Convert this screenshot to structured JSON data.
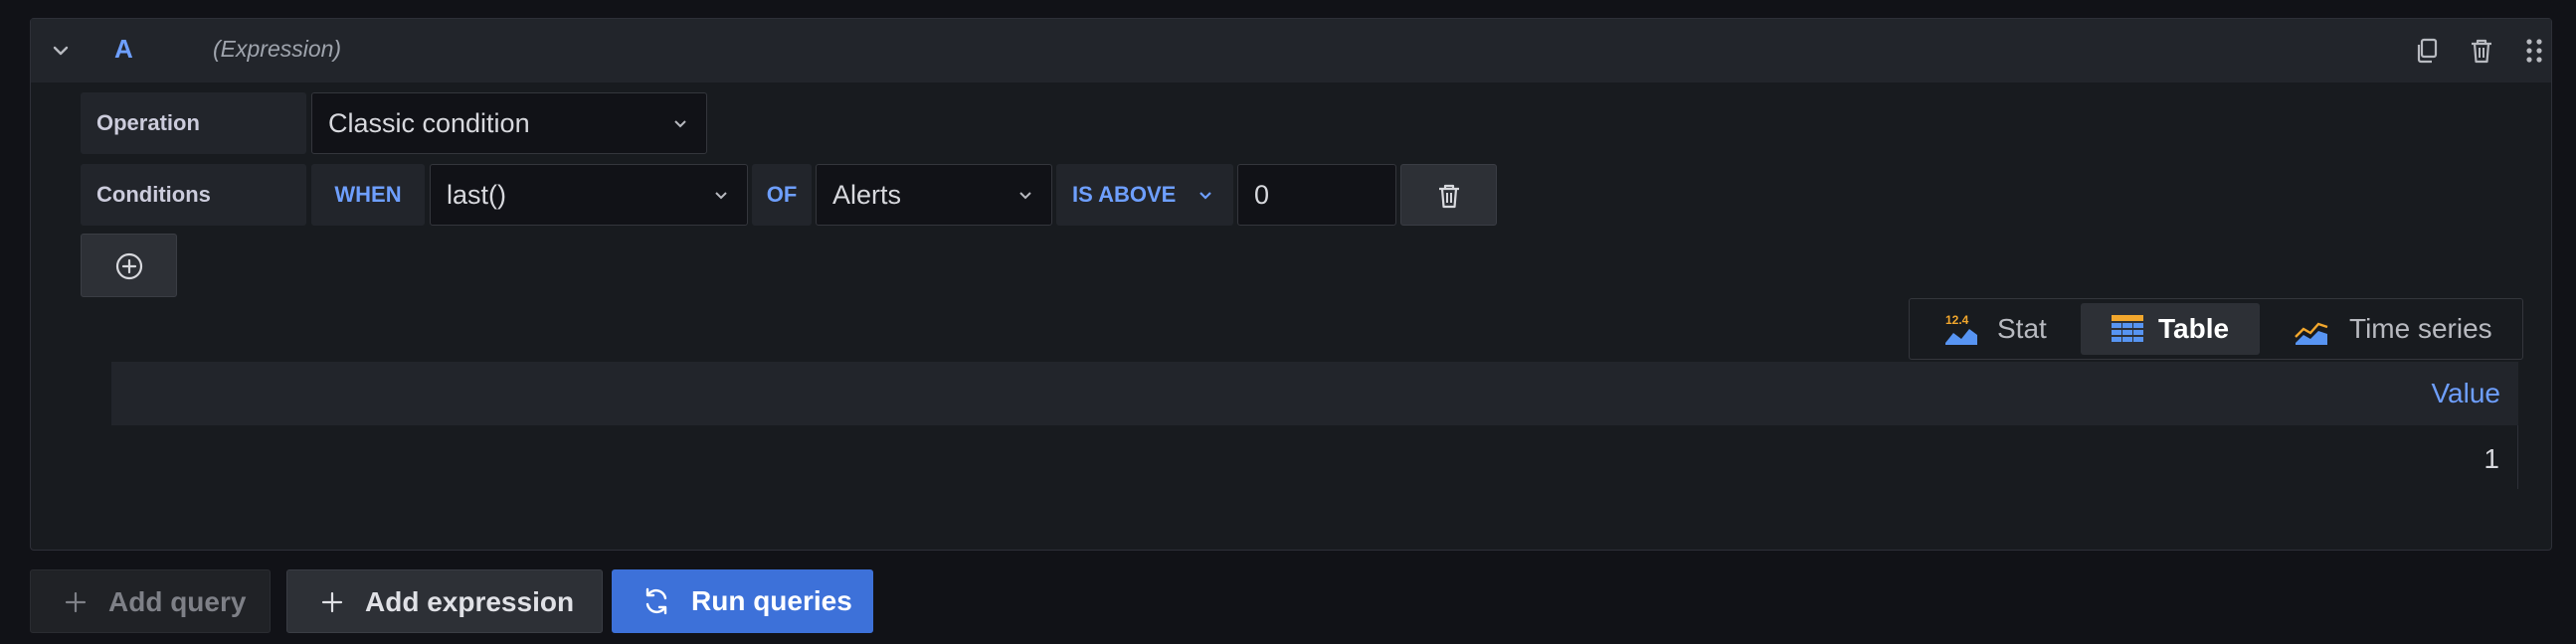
{
  "query": {
    "ref_id": "A",
    "type_label": "(Expression)"
  },
  "operation": {
    "label": "Operation",
    "value": "Classic condition"
  },
  "conditions": {
    "label": "Conditions",
    "when": "WHEN",
    "reducer": "last()",
    "of": "OF",
    "query": "Alerts",
    "evaluator": "IS ABOVE",
    "threshold": "0"
  },
  "viz": {
    "options": [
      {
        "label": "Stat",
        "icon": "stat-icon",
        "badge": "12.4"
      },
      {
        "label": "Table",
        "icon": "table-icon"
      },
      {
        "label": "Time series",
        "icon": "time-series-icon"
      }
    ],
    "selected": "Table"
  },
  "table": {
    "columns": [
      "Value"
    ],
    "rows": [
      [
        "1"
      ]
    ]
  },
  "actions": {
    "add_query": "Add query",
    "add_expression": "Add expression",
    "run_queries": "Run queries"
  },
  "colors": {
    "accent": "#6e9fff",
    "primary_button": "#3d71d9",
    "background": "#111217",
    "panel": "#181b1f"
  }
}
